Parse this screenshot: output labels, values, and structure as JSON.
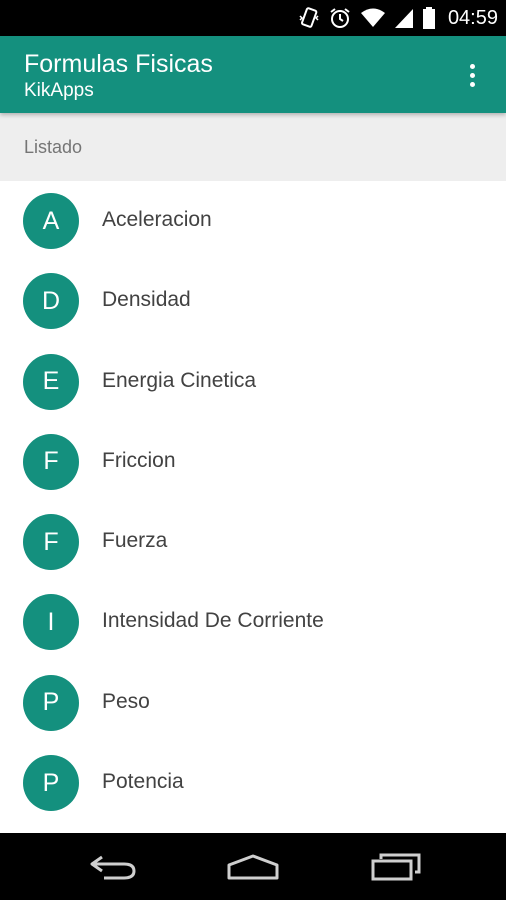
{
  "status_bar": {
    "time": "04:59",
    "icons": [
      "vibrate-icon",
      "alarm-icon",
      "wifi-icon",
      "signal-icon",
      "battery-icon"
    ]
  },
  "app_bar": {
    "title": "Formulas Fisicas",
    "subtitle": "KikApps",
    "background_color": "#14907e",
    "menu_icon": "overflow-menu-icon"
  },
  "section": {
    "header": "Listado"
  },
  "list": {
    "items": [
      {
        "letter": "A",
        "label": "Aceleracion"
      },
      {
        "letter": "D",
        "label": "Densidad"
      },
      {
        "letter": "E",
        "label": "Energia Cinetica"
      },
      {
        "letter": "F",
        "label": "Friccion"
      },
      {
        "letter": "F",
        "label": "Fuerza"
      },
      {
        "letter": "I",
        "label": "Intensidad De Corriente"
      },
      {
        "letter": "P",
        "label": "Peso"
      },
      {
        "letter": "P",
        "label": "Potencia"
      }
    ]
  },
  "nav_bar": {
    "icons": [
      "back-icon",
      "home-icon",
      "recents-icon"
    ]
  }
}
